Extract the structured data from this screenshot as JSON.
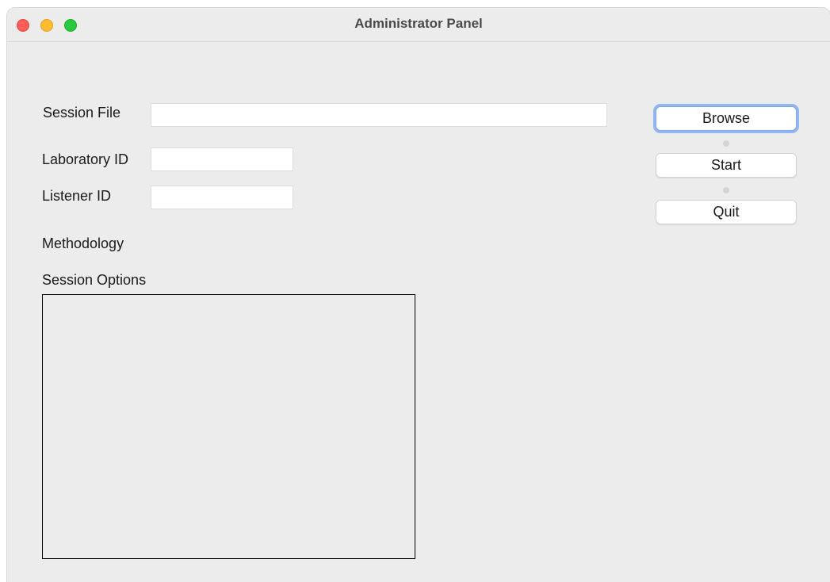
{
  "window": {
    "title": "Administrator Panel"
  },
  "form": {
    "session_file": {
      "label": "Session File",
      "value": "",
      "placeholder": ""
    },
    "laboratory_id": {
      "label": "Laboratory ID",
      "value": "",
      "placeholder": ""
    },
    "listener_id": {
      "label": "Listener ID",
      "value": "",
      "placeholder": ""
    },
    "methodology_label": "Methodology",
    "session_options_label": "Session Options"
  },
  "buttons": {
    "browse": "Browse",
    "start": "Start",
    "quit": "Quit"
  },
  "colors": {
    "window_bg": "#ececec",
    "focus_ring": "#93b6ee",
    "close": "#ff5f57",
    "minimize": "#febc2e",
    "maximize": "#28c840"
  }
}
